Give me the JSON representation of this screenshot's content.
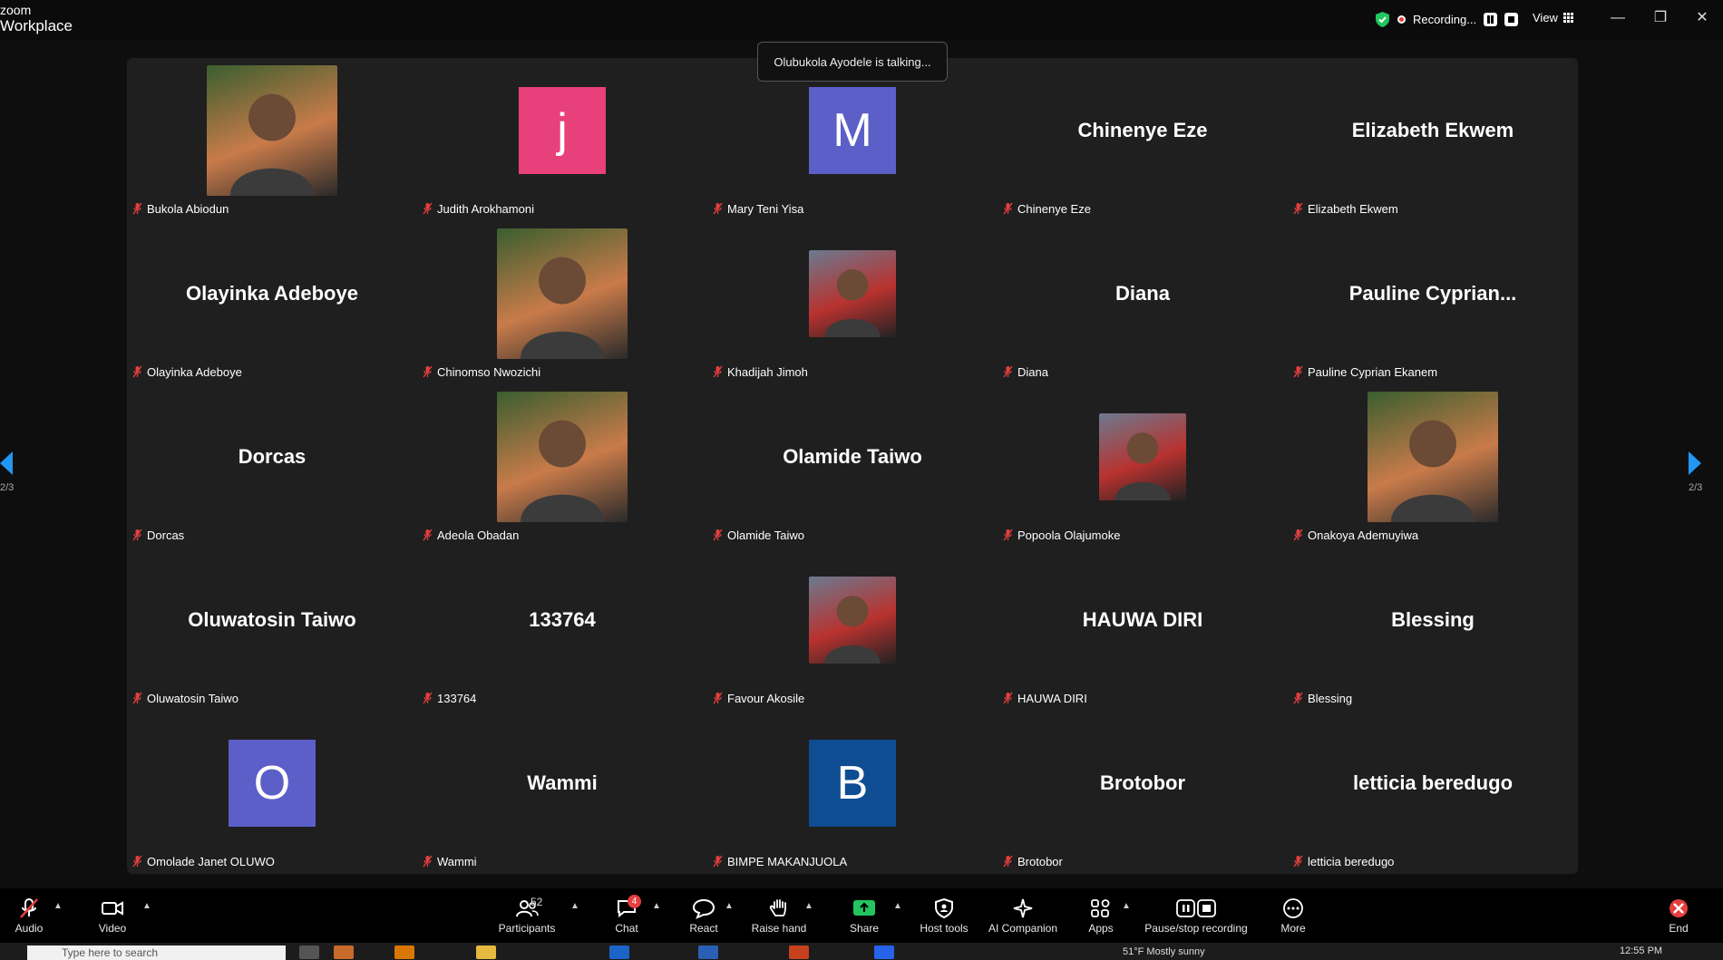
{
  "app": {
    "title_line1": "zoom",
    "title_line2": "Workplace"
  },
  "top": {
    "recording_label": "Recording...",
    "view_label": "View",
    "window_minimize": "—",
    "window_restore": "❐",
    "window_close": "✕"
  },
  "toast": "Olubukola Ayodele is talking...",
  "pager": {
    "left": "2/3",
    "right": "2/3"
  },
  "tiles": [
    {
      "label": "Bukola Abiodun",
      "display": "photo"
    },
    {
      "label": "Judith Arokhamoni",
      "display": "letter",
      "letter": "j",
      "color": "#e8407a"
    },
    {
      "label": "Mary Teni Yisa",
      "display": "letter",
      "letter": "M",
      "color": "#5b5fc7"
    },
    {
      "label": "Chinenye Eze",
      "display": "name",
      "name": "Chinenye Eze"
    },
    {
      "label": "Elizabeth Ekwem",
      "display": "name",
      "name": "Elizabeth Ekwem"
    },
    {
      "label": "Olayinka Adeboye",
      "display": "name",
      "name": "Olayinka Adeboye"
    },
    {
      "label": "Chinomso Nwozichi",
      "display": "photo"
    },
    {
      "label": "Khadijah Jimoh",
      "display": "photo-sm"
    },
    {
      "label": "Diana",
      "display": "name",
      "name": "Diana"
    },
    {
      "label": "Pauline Cyprian Ekanem",
      "display": "name",
      "name": "Pauline  Cyprian..."
    },
    {
      "label": "Dorcas",
      "display": "name",
      "name": "Dorcas"
    },
    {
      "label": "Adeola Obadan",
      "display": "photo"
    },
    {
      "label": "Olamide Taiwo",
      "display": "name",
      "name": "Olamide Taiwo"
    },
    {
      "label": "Popoola Olajumoke",
      "display": "photo-sm"
    },
    {
      "label": "Onakoya Ademuyiwa",
      "display": "photo"
    },
    {
      "label": "Oluwatosin Taiwo",
      "display": "name",
      "name": "Oluwatosin Taiwo"
    },
    {
      "label": "133764",
      "display": "name",
      "name": "133764"
    },
    {
      "label": "Favour Akosile",
      "display": "photo-sm"
    },
    {
      "label": "HAUWA DIRI",
      "display": "name",
      "name": "HAUWA DIRI"
    },
    {
      "label": "Blessing",
      "display": "name",
      "name": "Blessing"
    },
    {
      "label": "Omolade Janet OLUWO",
      "display": "letter",
      "letter": "O",
      "color": "#5b5fc7"
    },
    {
      "label": "Wammi",
      "display": "name",
      "name": "Wammi"
    },
    {
      "label": "BIMPE MAKANJUOLA",
      "display": "letter",
      "letter": "B",
      "color": "#0e4d92"
    },
    {
      "label": "Brotobor",
      "display": "name",
      "name": "Brotobor"
    },
    {
      "label": "letticia beredugo",
      "display": "name",
      "name": "letticia beredugo"
    }
  ],
  "toolbar": {
    "audio": "Audio",
    "video": "Video",
    "participants": "Participants",
    "participants_count": "52",
    "chat": "Chat",
    "chat_badge": "4",
    "react": "React",
    "raise_hand": "Raise hand",
    "share": "Share",
    "host_tools": "Host tools",
    "ai_companion": "AI Companion",
    "apps": "Apps",
    "pause_stop": "Pause/stop recording",
    "more": "More",
    "end": "End"
  },
  "taskbar": {
    "search_placeholder": "Type here to search",
    "weather": "51°F  Mostly sunny",
    "time": "12:55 PM"
  },
  "colors": {
    "accent": "#0b5cff",
    "tile_bg": "#1f1f1f",
    "mute_red": "#e53e3e",
    "share_green": "#22c55e"
  }
}
